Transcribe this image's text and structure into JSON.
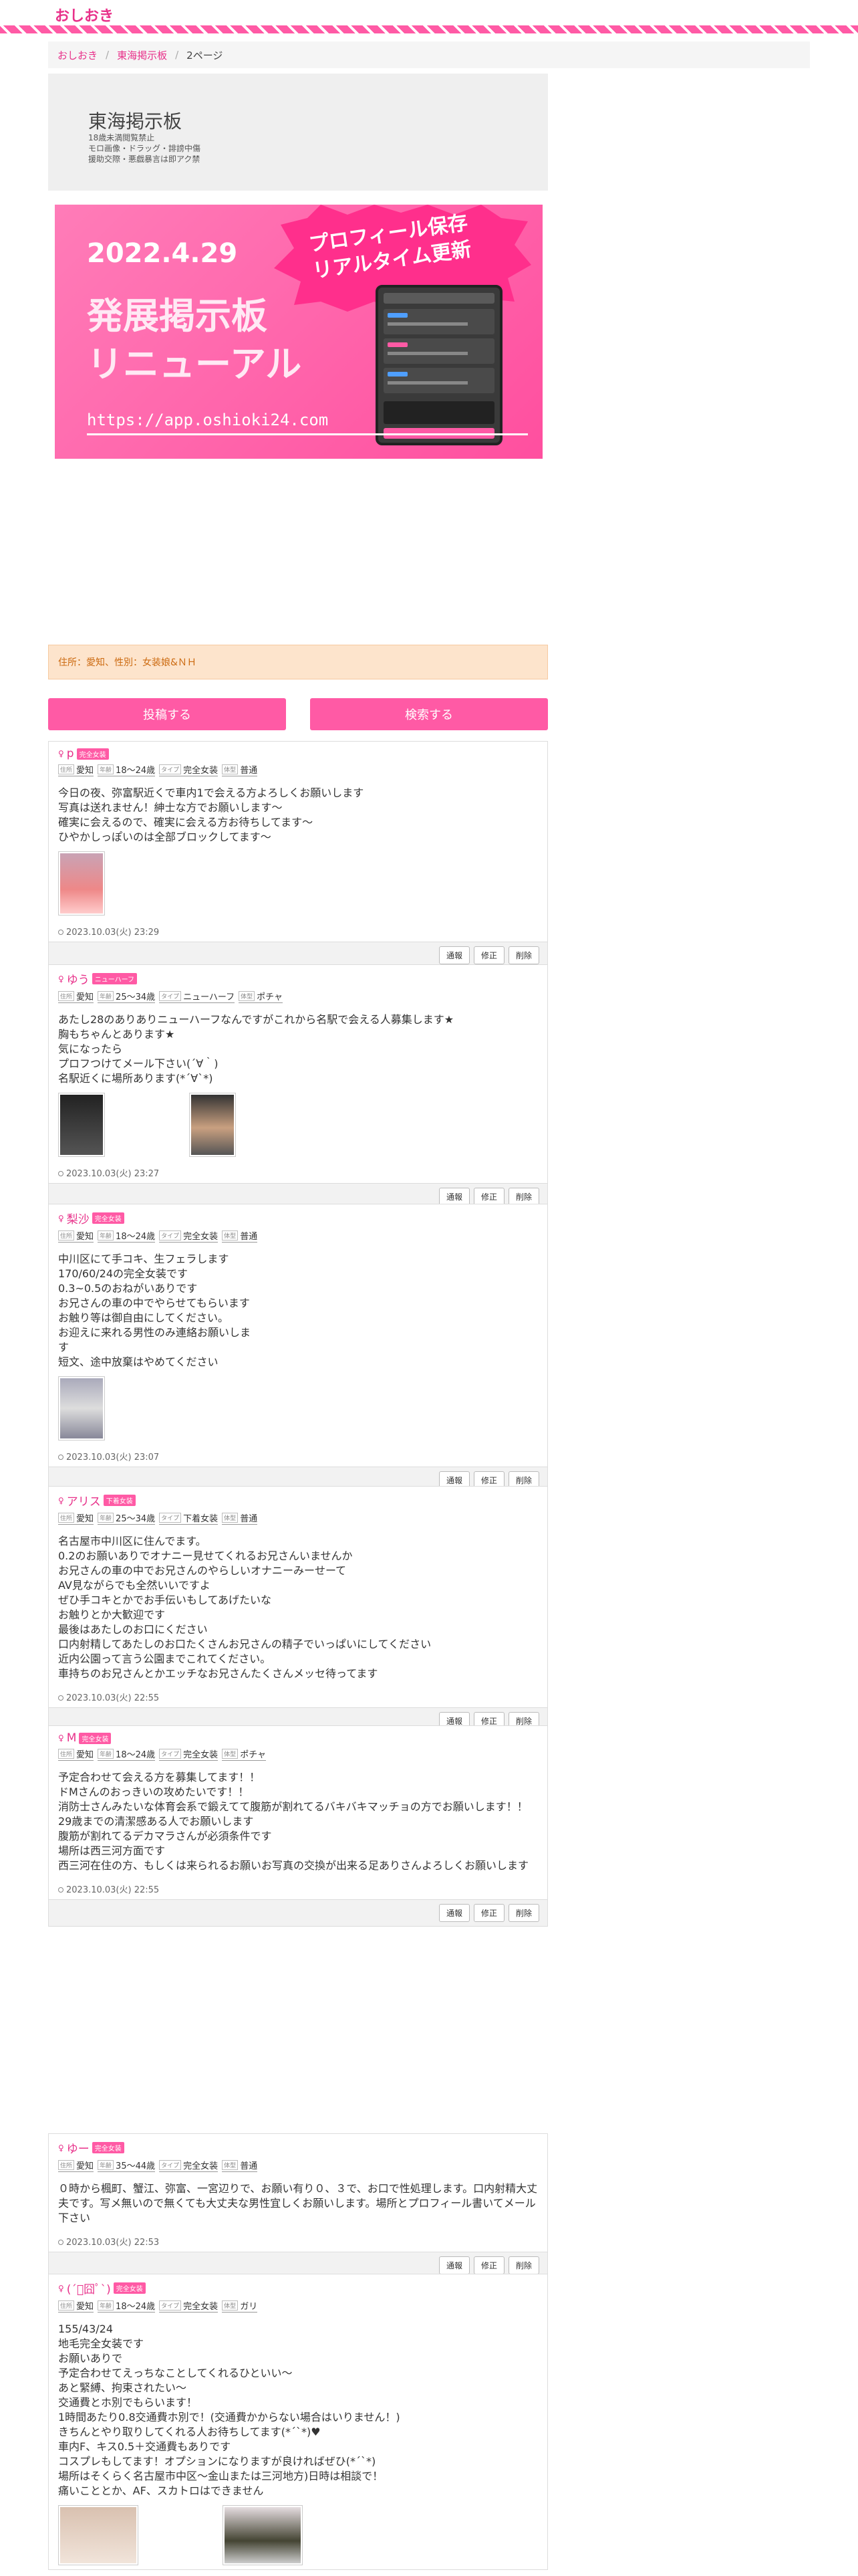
{
  "site": {
    "logo": "おしおき"
  },
  "breadcrumb": {
    "home": "おしおき",
    "board": "東海掲示板",
    "current": "2ページ"
  },
  "board": {
    "title": "東海掲示板",
    "notes": [
      "18歳未満閲覧禁止",
      "モロ画像・ドラッグ・誹謗中傷",
      "援助交際・悪戯暴言は即アク禁"
    ]
  },
  "banner": {
    "date": "2022.4.29",
    "line1": "発展掲示板",
    "line2": "リニューアル",
    "url": "https://app.oshioki24.com",
    "bubble1": "プロフィール保存",
    "bubble2": "リアルタイム更新"
  },
  "filter": {
    "text": "住所：愛知、性別：女装娘&ＮＨ"
  },
  "actions": {
    "post": "投稿する",
    "search": "検索する"
  },
  "labels": {
    "address": "住所",
    "age": "年齢",
    "type": "タイプ",
    "body": "体型",
    "report": "通報",
    "edit": "修正",
    "delete": "削除"
  },
  "colors": {
    "accent": "#ff5aa5",
    "link": "#e8318a",
    "filter_bg": "#fde4cc"
  },
  "posts": [
    {
      "name": "p",
      "badge": "完全女装",
      "address": "愛知",
      "age": "18〜24歳",
      "type": "完全女装",
      "body": "普通",
      "text": "今日の夜、弥富駅近くで車内1で会える方よろしくお願いします\n写真は送れません！紳士な方でお願いします〜\n確実に会えるので、確実に会える方お待ちしてます〜\nひやかしっぽいのは全部ブロックしてます〜",
      "date": "2023.10.03(火) 23:29"
    },
    {
      "name": "ゆう",
      "badge": "ニューハーフ",
      "address": "愛知",
      "age": "25〜34歳",
      "type": "ニューハーフ",
      "body": "ポチャ",
      "text": "あたし28のありありニューハーフなんですがこれから名駅で会える人募集します★\n胸もちゃんとあります★\n気になったら\nプロフつけてメール下さい(´∀｀)\n名駅近くに場所あります(*´∀`*)",
      "date": "2023.10.03(火) 23:27"
    },
    {
      "name": "梨沙",
      "badge": "完全女装",
      "address": "愛知",
      "age": "18〜24歳",
      "type": "完全女装",
      "body": "普通",
      "text": "中川区にて手コキ、生フェラします\n170/60/24の完全女装です\n0.3~0.5のおねがいありです\nお兄さんの車の中でやらせてもらいます\nお触り等は御自由にしてください。\nお迎えに来れる男性のみ連絡お願いしま\nす\n短文、途中放棄はやめてください",
      "date": "2023.10.03(火) 23:07"
    },
    {
      "name": "アリス",
      "badge": "下着女装",
      "address": "愛知",
      "age": "25〜34歳",
      "type": "下着女装",
      "body": "普通",
      "text": "名古屋市中川区に住んでます。\n0.2のお願いありでオナニー見せてくれるお兄さんいませんか\nお兄さんの車の中でお兄さんのやらしいオナニーみーせーて\nAV見ながらでも全然いいですよ\nぜひ手コキとかでお手伝いもしてあげたいな\nお触りとか大歓迎です\n最後はあたしのお口にください\n口内射精してあたしのお口たくさんお兄さんの精子でいっぱいにしてください\n近内公園って言う公園までこれてください。\n車持ちのお兄さんとかエッチなお兄さんたくさんメッセ待ってます",
      "date": "2023.10.03(火) 22:55"
    },
    {
      "name": "M",
      "badge": "完全女装",
      "address": "愛知",
      "age": "18〜24歳",
      "type": "完全女装",
      "body": "ポチャ",
      "text": "予定合わせて会える方を募集してます！！\nドMさんのおっきいの攻めたいです！！\n消防士さんみたいな体育会系で鍛えてて腹筋が割れてるバキバキマッチョの方でお願いします！！\n29歳までの清潔感ある人でお願いします\n腹筋が割れてるデカマラさんが必須条件です\n場所は西三河方面です\n西三河在住の方、もしくは来られるお願いお写真の交換が出来る足ありさんよろしくお願いします",
      "date": "2023.10.03(火) 22:55"
    },
    {
      "name": "ゆー",
      "badge": "完全女装",
      "address": "愛知",
      "age": "35〜44歳",
      "type": "完全女装",
      "body": "普通",
      "text": "０時から楓町、蟹江、弥富、一宮辺りで、お願い有り０、３で、お口で性処理します。口内射精大丈夫です。写メ無いので無くても大丈夫な男性宜しくお願いします。場所とプロフィール書いてメール下さい",
      "date": "2023.10.03(火) 22:53"
    },
    {
      "name": "(´ﾟ囧ﾟ`)",
      "badge": "完全女装",
      "address": "愛知",
      "age": "18〜24歳",
      "type": "完全女装",
      "body": "ガリ",
      "text": "155/43/24\n地毛完全女装です\nお願いありで\n予定合わせてえっちなことしてくれるひといい〜\nあと緊縛、拘束されたい〜\n交通費とホ別でもらいます！\n1時間あたり0.8交通費ホ別で！(交通費かからない場合はいりません！)\nきちんとやり取りしてくれる人お待ちしてます(*´`*)♥\n車内F、キス0.5＋交通費もありです\nコスプレもしてます！オプションになりますが良ければぜひ(*´`*)\n場所はそくらく名古屋市中区〜金山または三河地方)日時は相談で！\n痛いこととか、AF、スカトロはできません",
      "date": ""
    }
  ]
}
